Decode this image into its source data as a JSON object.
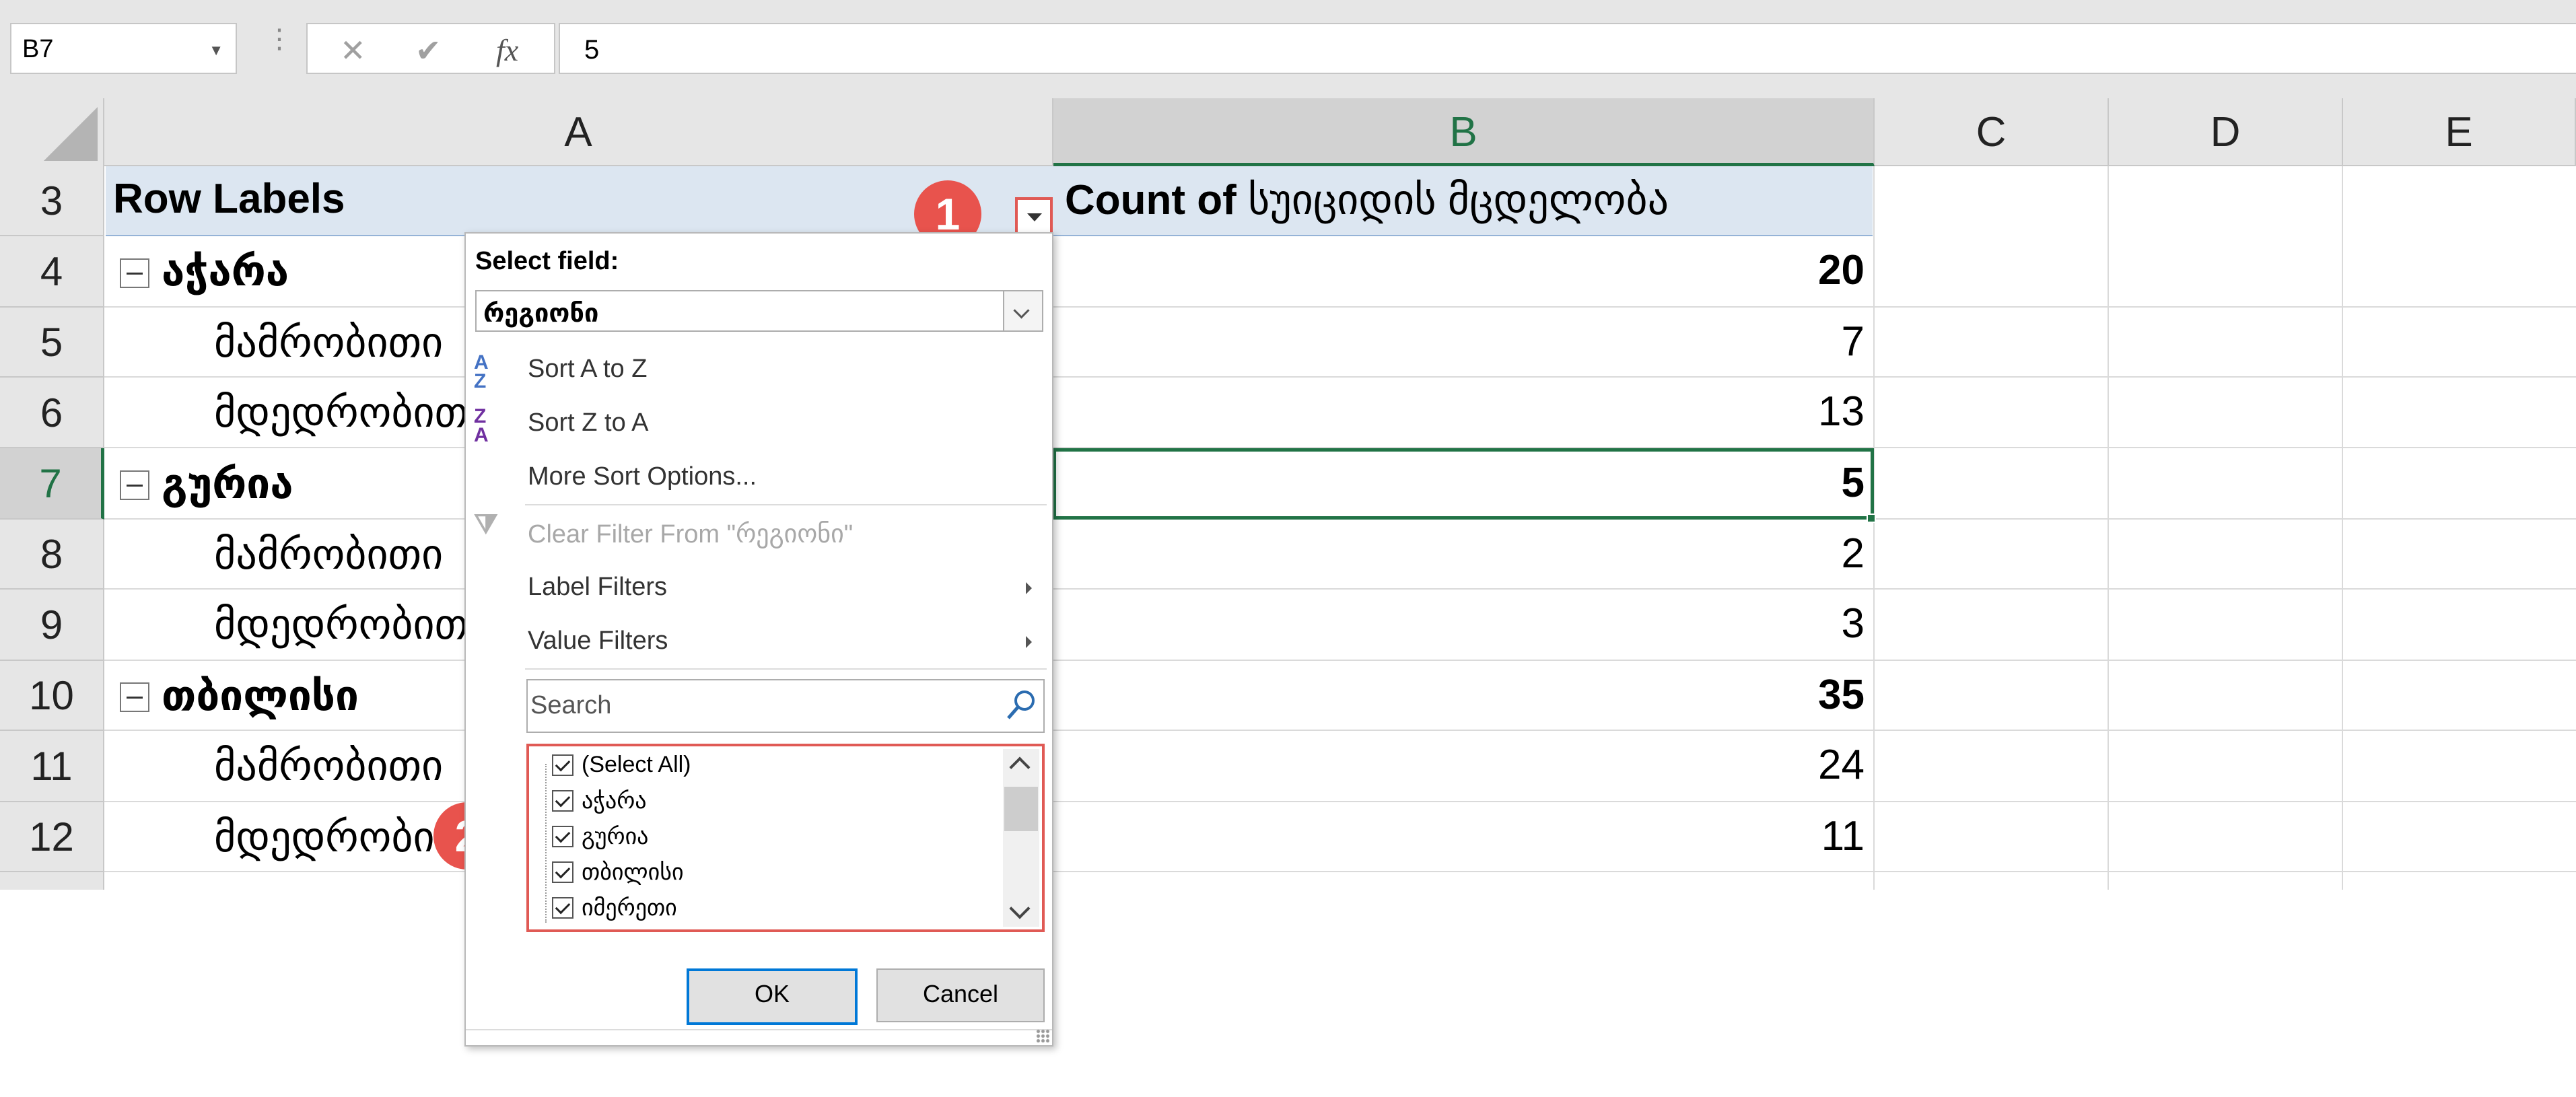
{
  "formula_bar": {
    "name_box": "B7",
    "cancel_icon": "✕",
    "enter_icon": "✔",
    "fx_label": "fx",
    "value": "5"
  },
  "columns": [
    "A",
    "B",
    "C",
    "D",
    "E"
  ],
  "selected_column": "B",
  "rows": [
    {
      "num": "3",
      "a": "Row Labels",
      "b": "Count of სუიციდის მცდელობა",
      "kind": "header"
    },
    {
      "num": "4",
      "a": "აჭარა",
      "b": "20",
      "kind": "group"
    },
    {
      "num": "5",
      "a": "მამრობითი",
      "b": "7",
      "kind": "item"
    },
    {
      "num": "6",
      "a": "მდედრობითი",
      "b": "13",
      "kind": "item"
    },
    {
      "num": "7",
      "a": "გურია",
      "b": "5",
      "kind": "group"
    },
    {
      "num": "8",
      "a": "მამრობითი",
      "b": "2",
      "kind": "item"
    },
    {
      "num": "9",
      "a": "მდედრობითი",
      "b": "3",
      "kind": "item"
    },
    {
      "num": "10",
      "a": "თბილისი",
      "b": "35",
      "kind": "group"
    },
    {
      "num": "11",
      "a": "მამრობითი",
      "b": "24",
      "kind": "item"
    },
    {
      "num": "12",
      "a": "მდედრობითი",
      "b": "11",
      "kind": "item"
    }
  ],
  "selected_row": "7",
  "badges": {
    "one": "1",
    "two": "2"
  },
  "filter_panel": {
    "select_field_label": "Select field:",
    "select_field_value": "რეგიონი",
    "sort_asc": "Sort A to Z",
    "sort_desc": "Sort Z to A",
    "more_sort": "More Sort Options...",
    "clear_filter": "Clear Filter From \"რეგიონი\"",
    "label_filters": "Label Filters",
    "value_filters": "Value Filters",
    "search_placeholder": "Search",
    "items": [
      {
        "label": "(Select All)",
        "checked": true
      },
      {
        "label": "აჭარა",
        "checked": true
      },
      {
        "label": "გურია",
        "checked": true
      },
      {
        "label": "თბილისი",
        "checked": true
      },
      {
        "label": "იმერეთი",
        "checked": true
      }
    ],
    "ok": "OK",
    "cancel": "Cancel"
  },
  "colors": {
    "accent_green": "#217346",
    "badge_red": "#e8534d",
    "pivot_header_blue": "#dce6f1"
  }
}
